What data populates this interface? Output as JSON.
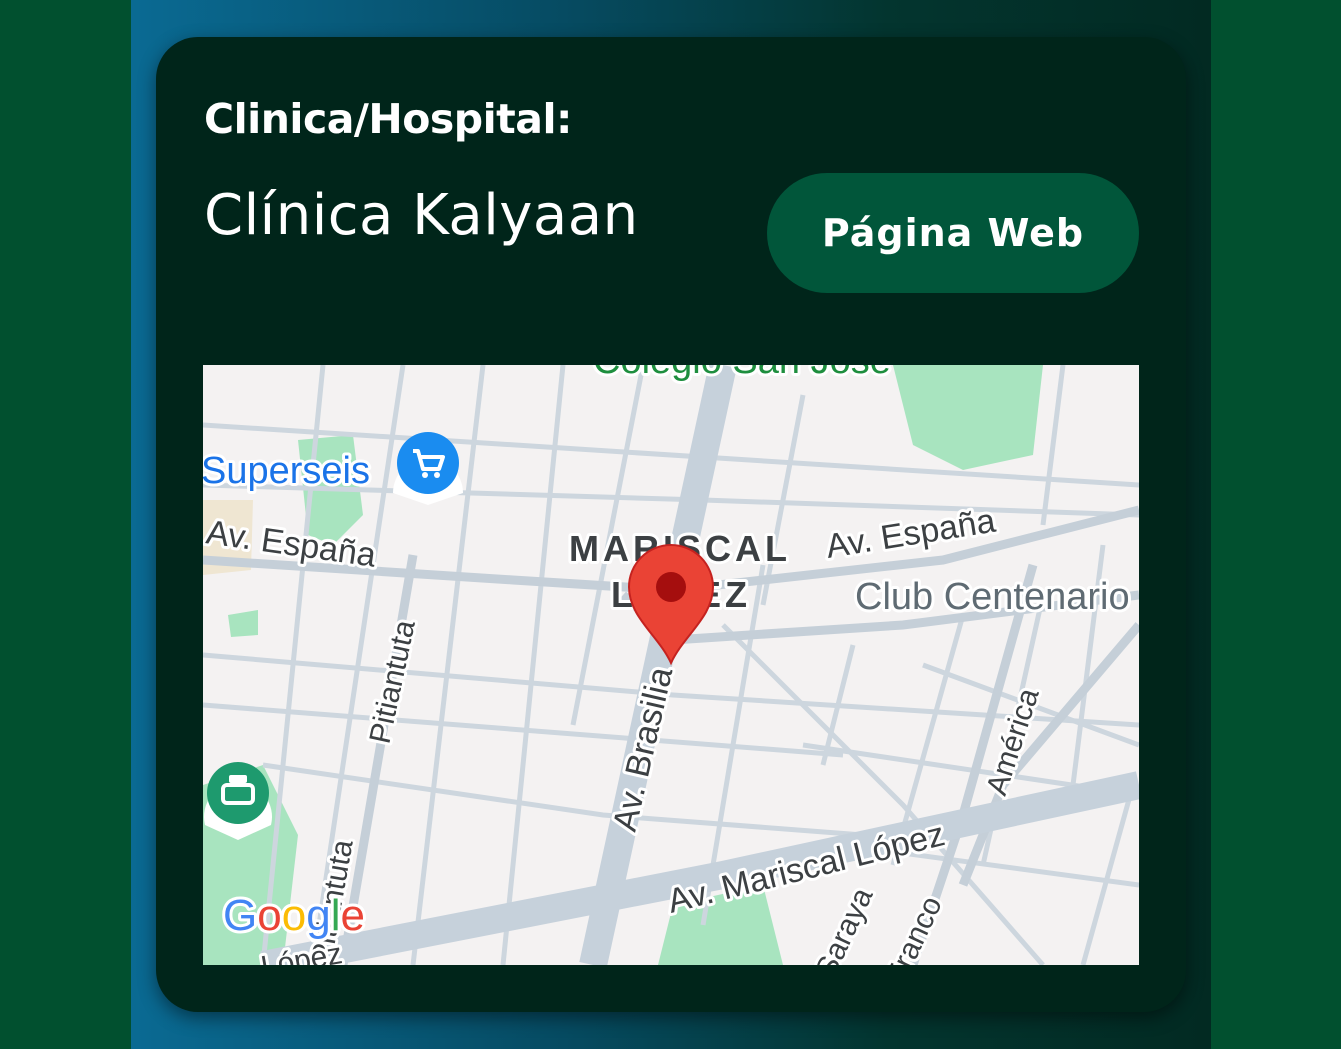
{
  "card": {
    "label": "Clinica/Hospital:",
    "name": "Clínica Kalyaan",
    "web_button": "Página Web"
  },
  "map": {
    "labels": {
      "top_place": "Colegio San José",
      "store": "Superseis",
      "street_espana_left": "Av. España",
      "street_espana_right": "Av. España",
      "district_line1": "MARISCAL",
      "district_line2": "LÓPEZ",
      "club": "Club Centenario",
      "pitiantuta_upper": "Pitiantuta",
      "pitiantuta_lower": "Pitiantuta",
      "brasilia": "Av. Brasilia",
      "america": "América",
      "mariscal_lopez": "Av. Mariscal López",
      "saraya": "Saraya",
      "franco": "Franco",
      "bottom_left": "López",
      "google": "Google"
    },
    "icons": [
      "shopping-cart-icon",
      "location-pin-icon",
      "store-chain-icon"
    ],
    "colors": {
      "map_bg": "#f4f2f2",
      "park": "#a8e4bf",
      "pin": "#ea4335",
      "store_pin": "#1a8cf0"
    }
  },
  "colors": {
    "page_bg": "#01502f",
    "card_bg": "#00251a",
    "button_bg": "#01563a"
  }
}
